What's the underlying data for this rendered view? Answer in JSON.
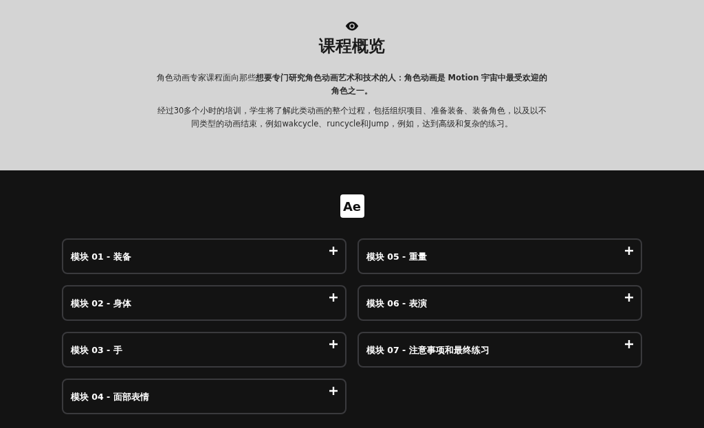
{
  "overview": {
    "title": "课程概览",
    "paragraphs": [
      "角色动画专家课程面向那些**想要专门研究角色动画艺术和技术的人：角色动画是 Motion 宇宙中最受欢迎的角色之一。**",
      "经过30多个小时的培训，学生将了解此类动画的整个过程，包括组织项目、准备装备、装备角色，以及以不同类型的动画结束，例如wakcycle、runcycle和Jump，例如，达到高级和复杂的练习。"
    ]
  },
  "modules": {
    "logo": "Ae",
    "items": [
      {
        "title": "模块 01 - 装备",
        "expanded": false
      },
      {
        "title": "模块 02 - 身体",
        "expanded": false
      },
      {
        "title": "模块 03 - 手",
        "expanded": false
      },
      {
        "title": "模块 04 - 面部表情",
        "expanded": false
      },
      {
        "title": "模块 05 - 重量",
        "expanded": false
      },
      {
        "title": "模块 06 - 表演",
        "expanded": false
      },
      {
        "title": "模块 07 - 注意事项和最终练习",
        "expanded": false
      }
    ]
  }
}
